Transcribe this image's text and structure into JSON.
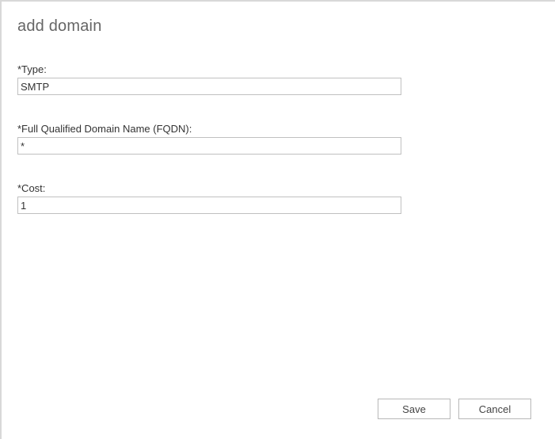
{
  "page": {
    "title": "add domain"
  },
  "fields": {
    "type": {
      "label": "*Type:",
      "value": "SMTP"
    },
    "fqdn": {
      "label": "*Full Qualified Domain Name (FQDN):",
      "value": "*"
    },
    "cost": {
      "label": "*Cost:",
      "value": "1"
    }
  },
  "buttons": {
    "save": "Save",
    "cancel": "Cancel"
  }
}
